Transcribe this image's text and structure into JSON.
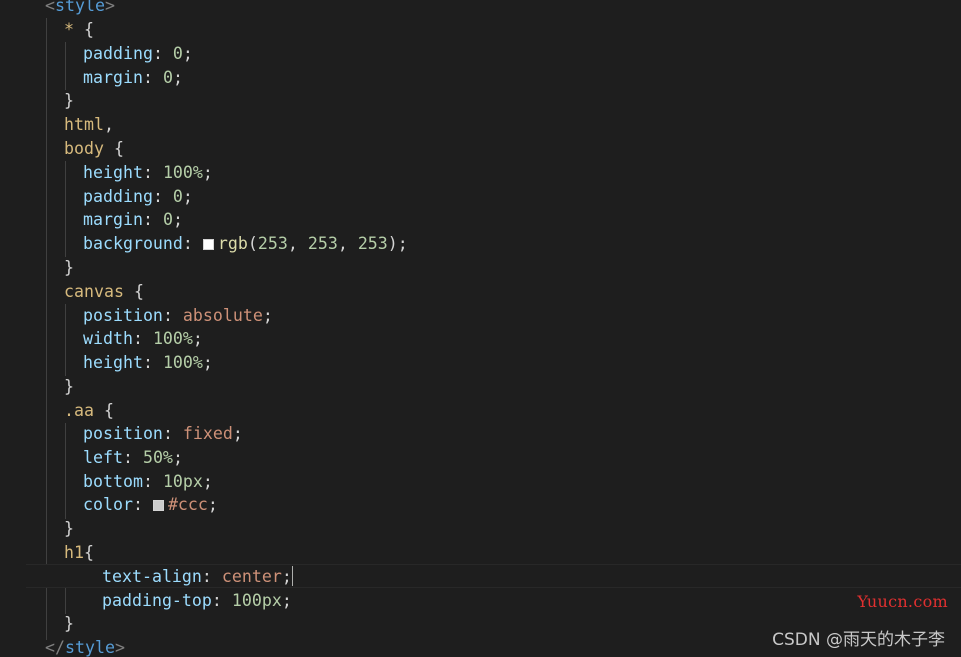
{
  "editor": {
    "theme_colors": {
      "background": "#1e1e1e",
      "tag": "#569cd6",
      "selector": "#d7ba7d",
      "property": "#9cdcfe",
      "number": "#b5cea8",
      "string_value": "#ce9178",
      "function": "#dcdcaa",
      "punctuation": "#808080",
      "text": "#d4d4d4"
    },
    "lines": {
      "l0": {
        "open_lt": "<",
        "tag": "style",
        "close_gt": ">"
      },
      "l1": {
        "selector": "*",
        "brace": " {"
      },
      "l2": {
        "prop": "padding",
        "colon": ": ",
        "value": "0",
        "semi": ";"
      },
      "l3": {
        "prop": "margin",
        "colon": ": ",
        "value": "0",
        "semi": ";"
      },
      "l4": {
        "brace": "}"
      },
      "l5": {
        "selector": "html",
        "comma": ","
      },
      "l6": {
        "selector": "body",
        "brace": " {"
      },
      "l7": {
        "prop": "height",
        "colon": ": ",
        "value": "100%",
        "semi": ";"
      },
      "l8": {
        "prop": "padding",
        "colon": ": ",
        "value": "0",
        "semi": ";"
      },
      "l9": {
        "prop": "margin",
        "colon": ": ",
        "value": "0",
        "semi": ";"
      },
      "l10": {
        "prop": "background",
        "colon": ": ",
        "fn": "rgb",
        "paren_open": "(",
        "a": "253",
        "sep1": ", ",
        "b": "253",
        "sep2": ", ",
        "c": "253",
        "paren_close": ")",
        "semi": ";",
        "swatch_color": "#fdfdfd"
      },
      "l11": {
        "brace": "}"
      },
      "l12": {
        "selector": "canvas",
        "brace": " {"
      },
      "l13": {
        "prop": "position",
        "colon": ": ",
        "value": "absolute",
        "semi": ";"
      },
      "l14": {
        "prop": "width",
        "colon": ": ",
        "value": "100%",
        "semi": ";"
      },
      "l15": {
        "prop": "height",
        "colon": ": ",
        "value": "100%",
        "semi": ";"
      },
      "l16": {
        "brace": "}"
      },
      "l17": {
        "selector": ".aa",
        "brace": " {"
      },
      "l18": {
        "prop": "position",
        "colon": ": ",
        "value": "fixed",
        "semi": ";"
      },
      "l19": {
        "prop": "left",
        "colon": ": ",
        "value": "50%",
        "semi": ";"
      },
      "l20": {
        "prop": "bottom",
        "colon": ": ",
        "value": "10px",
        "semi": ";"
      },
      "l21": {
        "prop": "color",
        "colon": ": ",
        "value": "#ccc",
        "semi": ";",
        "swatch_color": "#cccccc"
      },
      "l22": {
        "brace": "}"
      },
      "l23": {
        "selector": "h1",
        "brace": "{"
      },
      "l24": {
        "prop": "text-align",
        "colon": ": ",
        "value": "center",
        "semi": ";"
      },
      "l25": {
        "prop": "padding-top",
        "colon": ": ",
        "value": "100px",
        "semi": ";"
      },
      "l26": {
        "brace": "}"
      },
      "l27": {
        "open_lt": "</",
        "tag": "style",
        "close_gt": ">"
      }
    }
  },
  "watermarks": {
    "site": "Yuucn.com",
    "author": "CSDN @雨天的木子李"
  }
}
